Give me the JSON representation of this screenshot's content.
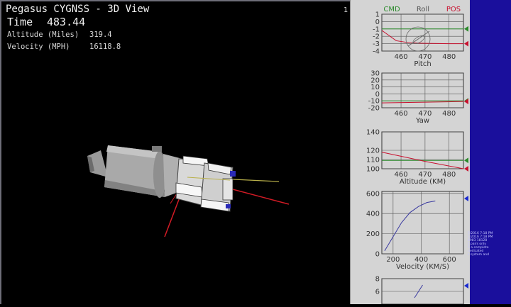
{
  "window": {
    "title": "Pegasus CYGNSS - 3D View",
    "viewport_index": "1"
  },
  "hud": {
    "time_label": "Time",
    "time_value": "483.44",
    "altitude_label": "Altitude (Miles)",
    "altitude_value": "319.4",
    "velocity_label": "Velocity (MPH)",
    "velocity_value": "16118.8"
  },
  "colors": {
    "background": "#000000",
    "panel": "#d4d4d4",
    "sidebar": "#1a0f9c",
    "cmd": "#2a8a2a",
    "pos": "#c8102e",
    "grid": "#555555",
    "curve": "#3a3aa0"
  },
  "chart_data": [
    {
      "type": "line",
      "title": "",
      "header_labels": [
        "CMD",
        "Roll",
        "POS"
      ],
      "ylim": [
        -4,
        1
      ],
      "yticks": [
        "1",
        "0",
        "-1",
        "-2",
        "-3",
        "-4"
      ],
      "xlim": [
        452,
        486
      ],
      "xticks": [
        "460",
        "470",
        "480"
      ],
      "xlabel": "Pitch",
      "series": [
        {
          "x": [
            452,
            466,
            486
          ],
          "y": [
            -1,
            -1,
            -1
          ]
        },
        {
          "x": [
            452,
            458,
            464,
            470,
            480,
            486
          ],
          "y": [
            -1.2,
            -2.6,
            -2.9,
            -2.95,
            -3.0,
            -3.0
          ]
        }
      ],
      "markers": [
        "cmd",
        "pos"
      ]
    },
    {
      "type": "line",
      "ylim": [
        -20,
        30
      ],
      "yticks": [
        "30",
        "20",
        "10",
        "0",
        "-10",
        "-20"
      ],
      "xlim": [
        452,
        486
      ],
      "xticks": [
        "460",
        "470",
        "480"
      ],
      "xlabel": "Yaw",
      "series": [
        {
          "x": [
            452,
            486
          ],
          "y": [
            -10,
            -10
          ]
        },
        {
          "x": [
            452,
            486
          ],
          "y": [
            -13,
            -11
          ]
        }
      ],
      "markers": [
        "cmd",
        "pos"
      ]
    },
    {
      "type": "line",
      "ylim": [
        100,
        140
      ],
      "yticks": [
        "140",
        "120",
        "110",
        "100"
      ],
      "xlim": [
        452,
        486
      ],
      "xticks": [
        "460",
        "470",
        "480"
      ],
      "xlabel": "Altitude (KM)",
      "series": [
        {
          "x": [
            452,
            486
          ],
          "y": [
            109,
            109
          ]
        },
        {
          "x": [
            452,
            470,
            486
          ],
          "y": [
            118,
            108,
            100
          ]
        }
      ],
      "markers": [
        "cmd",
        "pos"
      ]
    },
    {
      "type": "line",
      "ylim": [
        0,
        620
      ],
      "yticks": [
        "600",
        "400",
        "200",
        "0"
      ],
      "xlim": [
        120,
        700
      ],
      "xticks": [
        "200",
        "400",
        "600"
      ],
      "xlabel": "Velocity (KM/S)",
      "series": [
        {
          "x": [
            140,
            200,
            260,
            320,
            380,
            440,
            500
          ],
          "y": [
            30,
            170,
            310,
            410,
            470,
            510,
            525
          ]
        }
      ],
      "markers": [
        "pos"
      ]
    },
    {
      "type": "line",
      "ylim": [
        4,
        8
      ],
      "yticks": [
        "8",
        "6"
      ],
      "xlim": [
        0,
        10
      ],
      "xticks": [],
      "xlabel": "",
      "series": [
        {
          "x": [
            4,
            5
          ],
          "y": [
            5,
            7
          ]
        }
      ],
      "markers": [
        "pos"
      ]
    }
  ],
  "sidebar": {
    "note_lines": [
      "5/2016 7:18 PM",
      "5/2016 7:18 PM",
      "8983 18128",
      "",
      "ll pairs only",
      "5 a complete",
      "dedicated",
      "s system and"
    ]
  }
}
